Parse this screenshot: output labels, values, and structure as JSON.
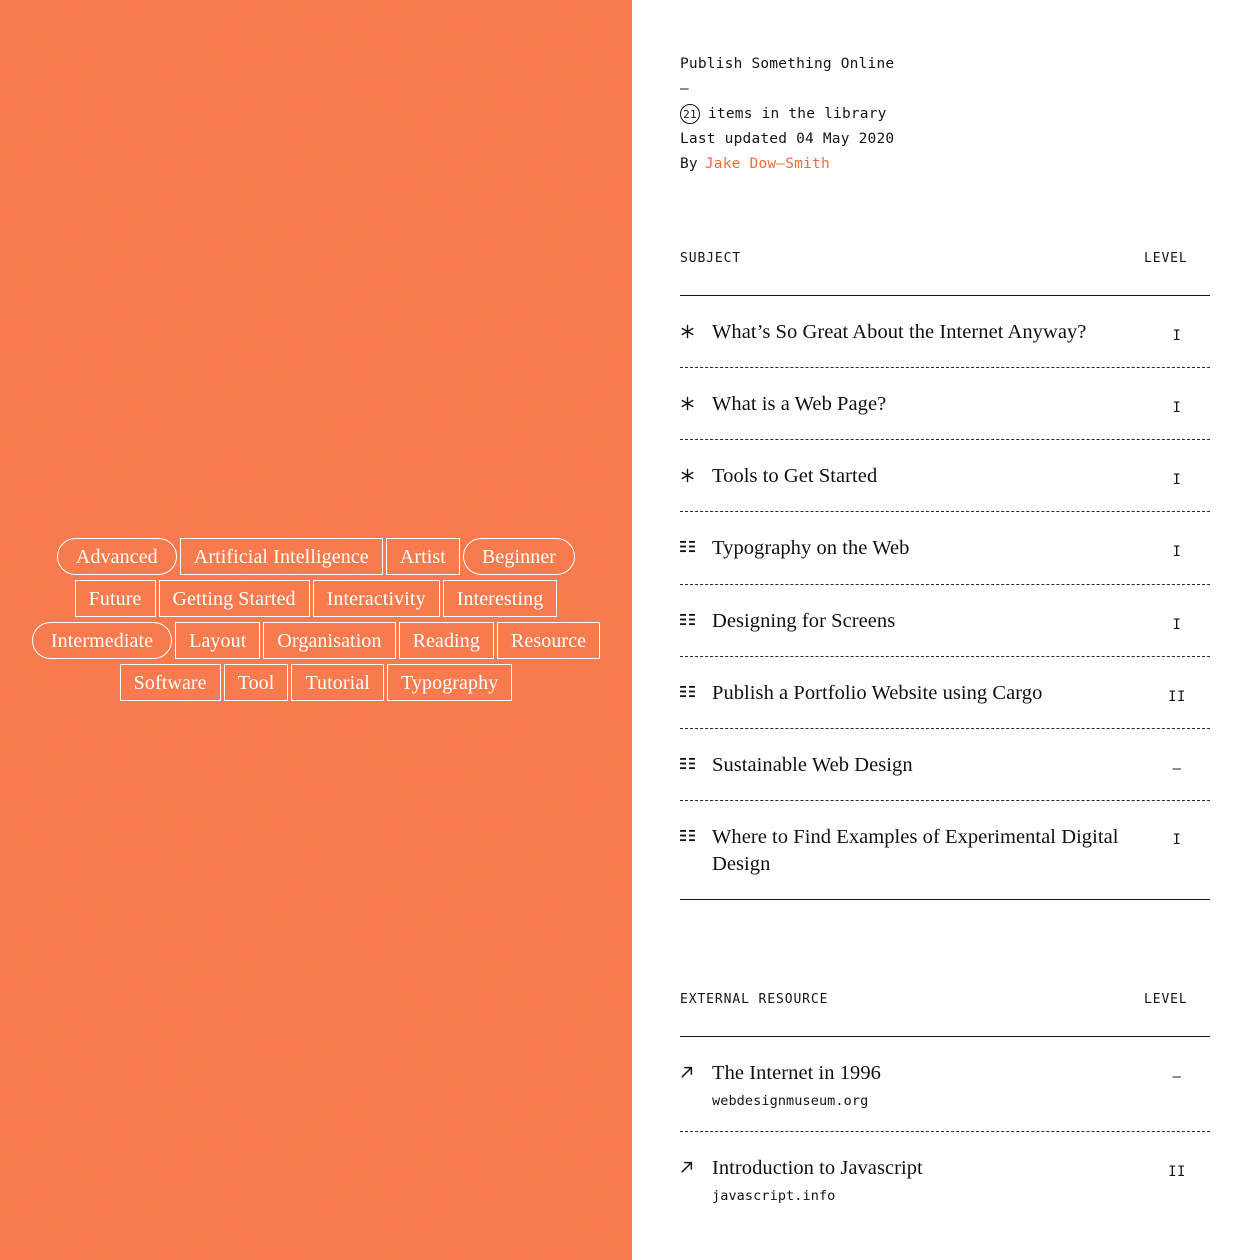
{
  "theme": {
    "accent": "#f97a4d",
    "link": "#f96a36",
    "ink": "#141414",
    "paper": "#ffffff"
  },
  "header": {
    "title": "Publish Something Online",
    "divider": "–",
    "count": "21",
    "count_label": "items in the library",
    "last_updated": "Last updated 04 May 2020",
    "by_label": "By",
    "author": "Jake Dow–Smith"
  },
  "tags": {
    "rows": [
      [
        {
          "label": "Advanced",
          "shape": "pill"
        },
        {
          "label": "Artificial Intelligence",
          "shape": "rect"
        },
        {
          "label": "Artist",
          "shape": "rect"
        },
        {
          "label": "Beginner",
          "shape": "pill"
        }
      ],
      [
        {
          "label": "Future",
          "shape": "rect"
        },
        {
          "label": "Getting Started",
          "shape": "rect"
        },
        {
          "label": "Interactivity",
          "shape": "rect"
        },
        {
          "label": "Interesting",
          "shape": "rect"
        }
      ],
      [
        {
          "label": "Intermediate",
          "shape": "pill"
        },
        {
          "label": "Layout",
          "shape": "rect"
        },
        {
          "label": "Organisation",
          "shape": "rect"
        },
        {
          "label": "Reading",
          "shape": "rect"
        },
        {
          "label": "Resource",
          "shape": "rect"
        }
      ],
      [
        {
          "label": "Software",
          "shape": "rect"
        },
        {
          "label": "Tool",
          "shape": "rect"
        },
        {
          "label": "Tutorial",
          "shape": "rect"
        },
        {
          "label": "Typography",
          "shape": "rect"
        }
      ]
    ]
  },
  "subjects": {
    "col_subject": "SUBJECT",
    "col_level": "LEVEL",
    "rows": [
      {
        "icon": "asterisk-icon",
        "title": "What’s So Great About the Internet Anyway?",
        "level": "I"
      },
      {
        "icon": "asterisk-icon",
        "title": "What is a Web Page?",
        "level": "I"
      },
      {
        "icon": "asterisk-icon",
        "title": "Tools to Get Started",
        "level": "I"
      },
      {
        "icon": "grid-icon",
        "title": "Typography on the Web",
        "level": "I"
      },
      {
        "icon": "grid-icon",
        "title": "Designing for Screens",
        "level": "I"
      },
      {
        "icon": "grid-icon",
        "title": "Publish a Portfolio Website using Cargo",
        "level": "II"
      },
      {
        "icon": "grid-icon",
        "title": "Sustainable Web Design",
        "level": "–"
      },
      {
        "icon": "grid-icon",
        "title": "Where to Find Examples of Experimental Digital Design",
        "level": "I"
      }
    ]
  },
  "external": {
    "col_resource": "EXTERNAL RESOURCE",
    "col_level": "LEVEL",
    "rows": [
      {
        "icon": "external-link-icon",
        "title": "The Internet in 1996",
        "url": "webdesignmuseum.org",
        "level": "–"
      },
      {
        "icon": "external-link-icon",
        "title": "Introduction to Javascript",
        "url": "javascript.info",
        "level": "II"
      }
    ]
  }
}
